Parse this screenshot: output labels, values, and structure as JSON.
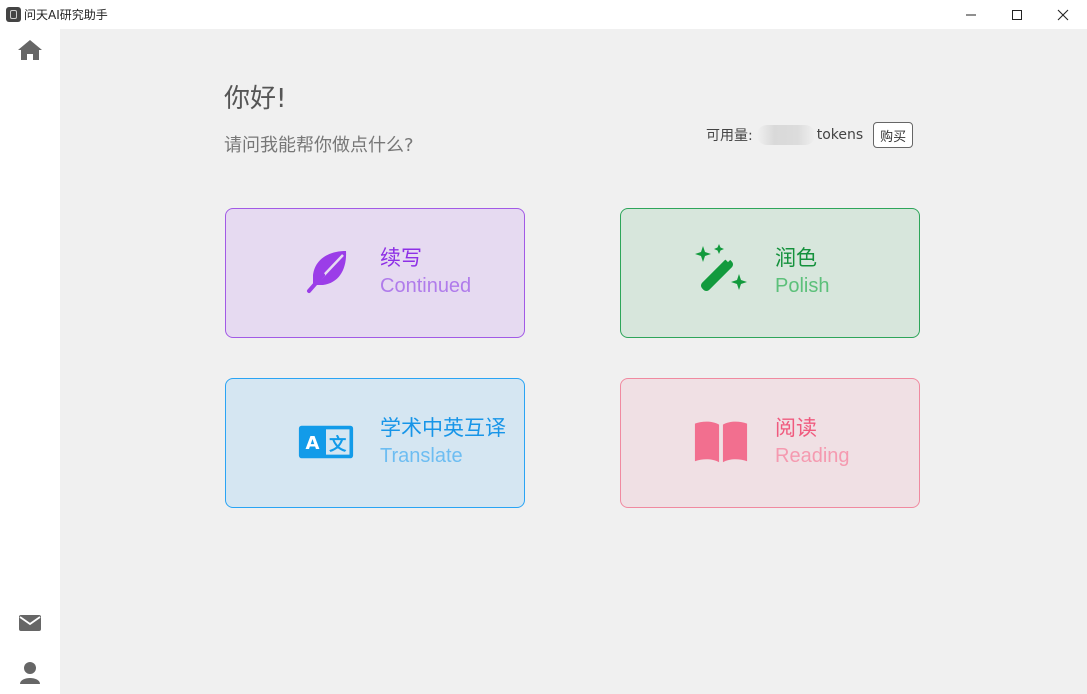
{
  "window": {
    "title": "问天AI研究助手",
    "controls": {
      "minimize": "minimize",
      "maximize": "maximize",
      "close": "close"
    }
  },
  "sidebar": {
    "top_icon": "home-icon",
    "bottom_icons": [
      "mail-icon",
      "user-icon"
    ]
  },
  "main": {
    "greeting": "你好!",
    "subtitle": "请问我能帮你做点什么?",
    "usage": {
      "label": "可用量:",
      "unit": "tokens",
      "buy_label": "购买"
    },
    "cards": {
      "continue": {
        "zh": "续写",
        "en": "Continued",
        "icon": "feather-icon",
        "color": "#8e30e6"
      },
      "polish": {
        "zh": "润色",
        "en": "Polish",
        "icon": "magic-wand-icon",
        "color": "#14913c"
      },
      "translate": {
        "zh": "学术中英互译",
        "en": "Translate",
        "icon": "translate-icon",
        "color": "#1795e8"
      },
      "reading": {
        "zh": "阅读",
        "en": "Reading",
        "icon": "book-icon",
        "color": "#f05a7e"
      }
    }
  }
}
